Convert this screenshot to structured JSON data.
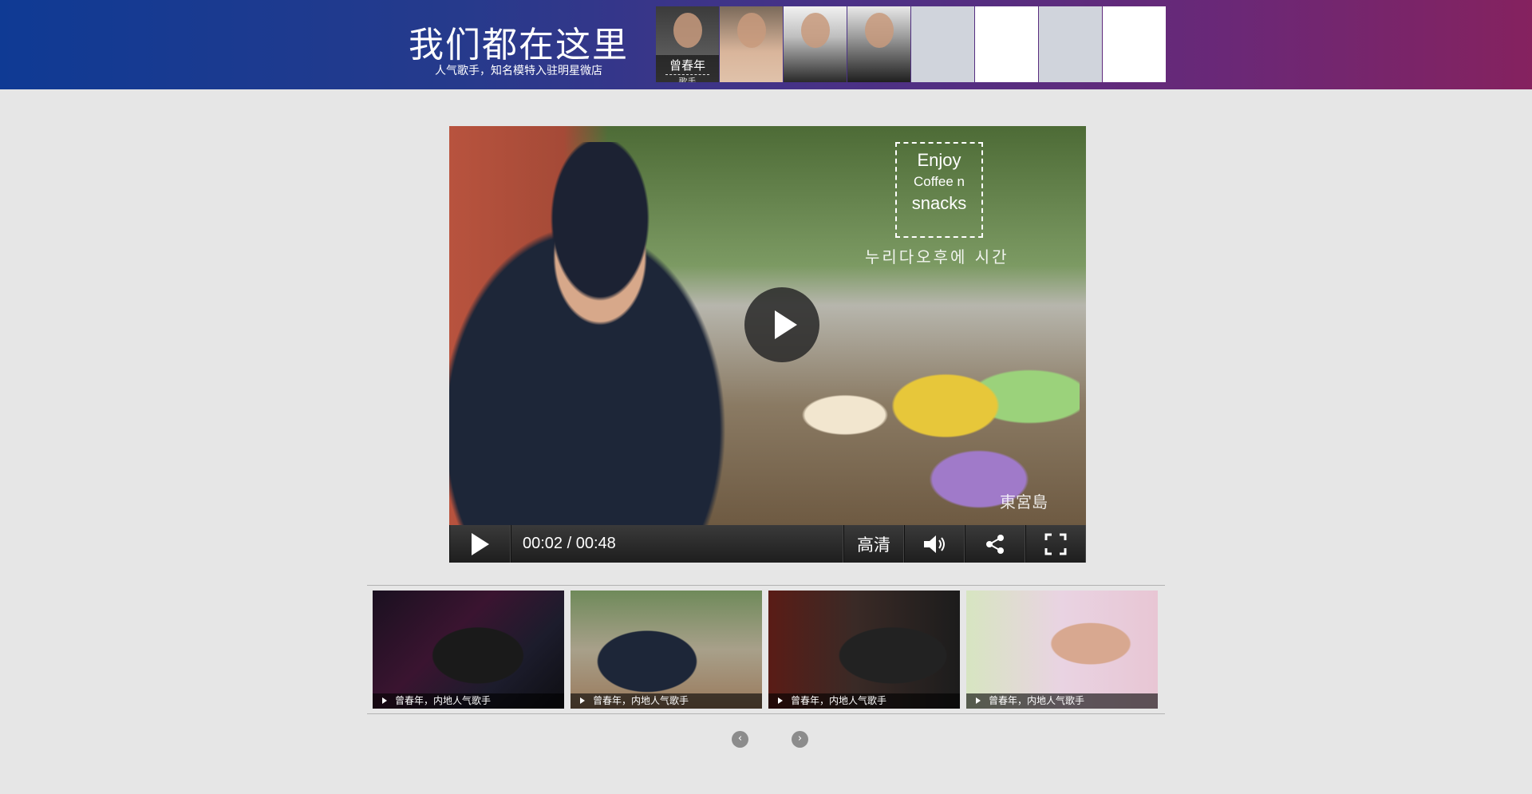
{
  "banner": {
    "title": "我们都在这里",
    "subtitle": "人气歌手，知名模特入驻明星微店",
    "stars": [
      {
        "name": "曾春年",
        "role": "歌手"
      },
      {
        "name": "",
        "role": ""
      },
      {
        "name": "",
        "role": ""
      },
      {
        "name": "",
        "role": ""
      }
    ],
    "colors": {
      "left": "#0f3a94",
      "right": "#85225f"
    }
  },
  "player": {
    "overlay_enjoy_line1": "Enjoy",
    "overlay_enjoy_line2": "Coffee n",
    "overlay_enjoy_line3": "snacks",
    "overlay_korean": "누리다오후에 시간",
    "watermark": "東宮島",
    "time": "00:02 / 00:48",
    "quality_label": "高清",
    "icons": [
      "play-icon",
      "volume-icon",
      "share-icon",
      "fullscreen-icon"
    ]
  },
  "thumbnails": [
    {
      "caption": "曾春年，内地人气歌手"
    },
    {
      "caption": "曾春年，内地人气歌手"
    },
    {
      "caption": "曾春年，内地人气歌手"
    },
    {
      "caption": "曾春年，内地人气歌手"
    }
  ],
  "nav": {
    "prev_symbol": "‹",
    "next_symbol": "›"
  }
}
